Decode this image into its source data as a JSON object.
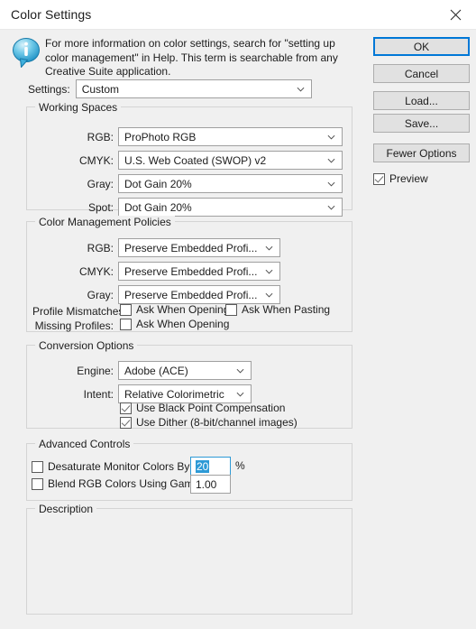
{
  "window": {
    "title": "Color Settings",
    "close_icon": "close-icon"
  },
  "info": {
    "icon": "info-bubble-icon",
    "text": "For more information on color settings, search for \"setting up color management\" in Help. This term is searchable from any Creative Suite application."
  },
  "buttons": {
    "ok": "OK",
    "cancel": "Cancel",
    "load": "Load...",
    "save": "Save...",
    "fewer_options": "Fewer Options"
  },
  "preview": {
    "label": "Preview",
    "checked": true
  },
  "settings": {
    "label": "Settings:",
    "value": "Custom"
  },
  "working_spaces": {
    "legend": "Working Spaces",
    "rows": [
      {
        "label": "RGB:",
        "value": "ProPhoto RGB"
      },
      {
        "label": "CMYK:",
        "value": "U.S. Web Coated (SWOP) v2"
      },
      {
        "label": "Gray:",
        "value": "Dot Gain 20%"
      },
      {
        "label": "Spot:",
        "value": "Dot Gain 20%"
      }
    ]
  },
  "policies": {
    "legend": "Color Management Policies",
    "rows": [
      {
        "label": "RGB:",
        "value": "Preserve Embedded Profi..."
      },
      {
        "label": "CMYK:",
        "value": "Preserve Embedded Profi..."
      },
      {
        "label": "Gray:",
        "value": "Preserve Embedded Profi..."
      }
    ],
    "profile_mismatches": {
      "label": "Profile Mismatches:",
      "ask_when_opening": "Ask When Opening",
      "ask_when_opening_checked": false,
      "ask_when_pasting": "Ask When Pasting",
      "ask_when_pasting_checked": false
    },
    "missing_profiles": {
      "label": "Missing Profiles:",
      "ask_when_opening": "Ask When Opening",
      "ask_when_opening_checked": false
    }
  },
  "conversion": {
    "legend": "Conversion Options",
    "engine": {
      "label": "Engine:",
      "value": "Adobe (ACE)"
    },
    "intent": {
      "label": "Intent:",
      "value": "Relative Colorimetric"
    },
    "black_point": {
      "label": "Use Black Point Compensation",
      "checked": true
    },
    "dither": {
      "label": "Use Dither (8-bit/channel images)",
      "checked": true
    }
  },
  "advanced": {
    "legend": "Advanced Controls",
    "desaturate": {
      "label": "Desaturate Monitor Colors By:",
      "checked": false,
      "value": "20",
      "unit": "%"
    },
    "blend": {
      "label": "Blend RGB Colors Using Gamma:",
      "checked": false,
      "value": "1.00"
    }
  },
  "description": {
    "legend": "Description",
    "text": ""
  },
  "colors": {
    "accent": "#0078d7",
    "dialog_bg": "#f0f0f0",
    "titlebar_bg": "#ffffff",
    "field_bg": "#ffffff",
    "selection": "#2d9ad6",
    "group_border": "#d4d4d4"
  }
}
